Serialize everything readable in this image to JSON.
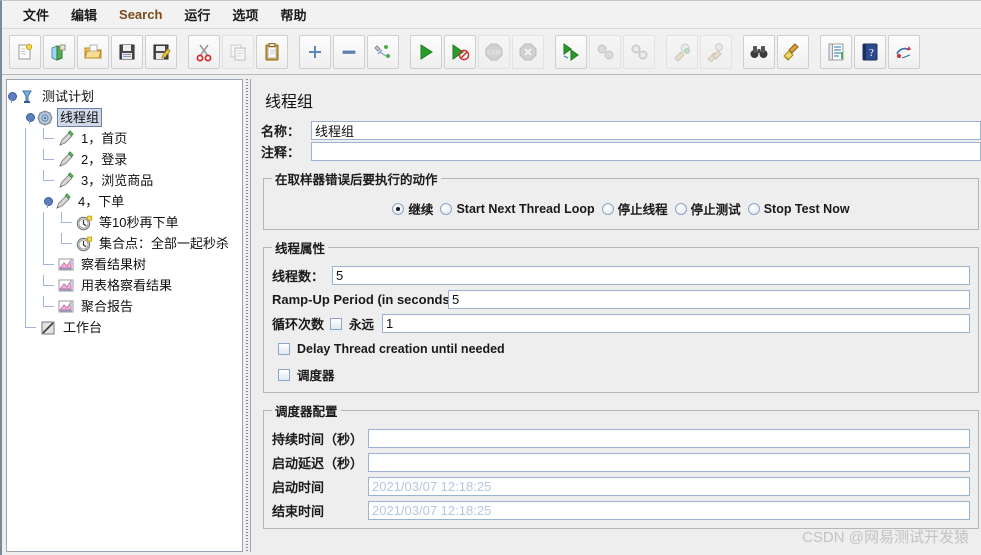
{
  "menubar": {
    "items": [
      {
        "label": "文件",
        "accent": false
      },
      {
        "label": "编辑",
        "accent": false
      },
      {
        "label": "Search",
        "accent": true
      },
      {
        "label": "运行",
        "accent": false
      },
      {
        "label": "选项",
        "accent": false
      },
      {
        "label": "帮助",
        "accent": false
      }
    ]
  },
  "toolbar": {
    "buttons": [
      {
        "icon": "new-file-icon",
        "disabled": false,
        "sep_after": false
      },
      {
        "icon": "templates-icon",
        "disabled": false,
        "sep_after": false
      },
      {
        "icon": "open-folder-icon",
        "disabled": false,
        "sep_after": false
      },
      {
        "icon": "save-icon",
        "disabled": false,
        "sep_after": false
      },
      {
        "icon": "save-as-icon",
        "disabled": false,
        "sep_after": true
      },
      {
        "icon": "cut-icon",
        "disabled": false,
        "sep_after": false
      },
      {
        "icon": "copy-icon",
        "disabled": true,
        "sep_after": false
      },
      {
        "icon": "paste-icon",
        "disabled": false,
        "sep_after": true
      },
      {
        "icon": "expand-all-icon",
        "disabled": false,
        "sep_after": false
      },
      {
        "icon": "collapse-all-icon",
        "disabled": false,
        "sep_after": false
      },
      {
        "icon": "toggle-icon",
        "disabled": false,
        "sep_after": true
      },
      {
        "icon": "start-icon",
        "disabled": false,
        "sep_after": false
      },
      {
        "icon": "start-no-pauses-icon",
        "disabled": false,
        "sep_after": false
      },
      {
        "icon": "stop-icon",
        "disabled": true,
        "sep_after": false
      },
      {
        "icon": "shutdown-icon",
        "disabled": true,
        "sep_after": true
      },
      {
        "icon": "start-remote-all-icon",
        "disabled": false,
        "sep_after": false
      },
      {
        "icon": "stop-remote-all-icon",
        "disabled": true,
        "sep_after": false
      },
      {
        "icon": "shutdown-remote-all-icon",
        "disabled": true,
        "sep_after": true
      },
      {
        "icon": "clear-icon",
        "disabled": true,
        "sep_after": false
      },
      {
        "icon": "clear-all-icon",
        "disabled": true,
        "sep_after": true
      },
      {
        "icon": "search-binoculars-icon",
        "disabled": false,
        "sep_after": false
      },
      {
        "icon": "reset-search-broom-icon",
        "disabled": false,
        "sep_after": true
      },
      {
        "icon": "function-helper-icon",
        "disabled": false,
        "sep_after": false
      },
      {
        "icon": "help-icon",
        "disabled": false,
        "sep_after": false
      },
      {
        "icon": "undo-redo-icon",
        "disabled": false,
        "sep_after": false
      }
    ]
  },
  "tree": {
    "nodes": [
      {
        "label": "测试计划",
        "icon": "test-plan-icon",
        "depth": 0,
        "selected": false,
        "expandable": true
      },
      {
        "label": "线程组",
        "icon": "thread-group-icon",
        "depth": 1,
        "selected": true,
        "expandable": true
      },
      {
        "label": "1，首页",
        "icon": "http-sampler-icon",
        "depth": 2,
        "selected": false,
        "expandable": false
      },
      {
        "label": "2，登录",
        "icon": "http-sampler-icon",
        "depth": 2,
        "selected": false,
        "expandable": false
      },
      {
        "label": "3，浏览商品",
        "icon": "http-sampler-icon",
        "depth": 2,
        "selected": false,
        "expandable": false
      },
      {
        "label": "4，下单",
        "icon": "http-sampler-icon",
        "depth": 2,
        "selected": false,
        "expandable": true
      },
      {
        "label": "等10秒再下单",
        "icon": "timer-icon",
        "depth": 3,
        "selected": false,
        "expandable": false
      },
      {
        "label": "集合点：全部一起秒杀",
        "icon": "timer-icon",
        "depth": 3,
        "selected": false,
        "expandable": false
      },
      {
        "label": "察看结果树",
        "icon": "listener-icon",
        "depth": 2,
        "selected": false,
        "expandable": false
      },
      {
        "label": "用表格察看结果",
        "icon": "listener-icon",
        "depth": 2,
        "selected": false,
        "expandable": false
      },
      {
        "label": "聚合报告",
        "icon": "listener-icon",
        "depth": 2,
        "selected": false,
        "expandable": false
      },
      {
        "label": "工作台",
        "icon": "workbench-icon",
        "depth": 1,
        "selected": false,
        "expandable": false
      }
    ]
  },
  "detail": {
    "title": "线程组",
    "name_label": "名称：",
    "name_value": "线程组",
    "comment_label": "注释：",
    "comment_value": "",
    "error_action": {
      "legend": "在取样器错误后要执行的动作",
      "options": [
        {
          "label": "继续",
          "checked": true
        },
        {
          "label": "Start Next Thread Loop",
          "checked": false
        },
        {
          "label": "停止线程",
          "checked": false
        },
        {
          "label": "停止测试",
          "checked": false
        },
        {
          "label": "Stop Test Now",
          "checked": false
        }
      ]
    },
    "thread_properties": {
      "legend": "线程属性",
      "thread_count_label": "线程数：",
      "thread_count_value": "5",
      "ramp_up_label": "Ramp-Up Period (in seconds):",
      "ramp_up_value": "5",
      "loop_label": "循环次数",
      "forever_label": "永远",
      "forever_checked": false,
      "loop_value": "1",
      "delay_thread_label": "Delay Thread creation until needed",
      "delay_thread_checked": false,
      "scheduler_label": "调度器",
      "scheduler_checked": false
    },
    "scheduler_config": {
      "legend": "调度器配置",
      "duration_label": "持续时间（秒）",
      "duration_value": "",
      "startup_delay_label": "启动延迟（秒）",
      "startup_delay_value": "",
      "start_time_label": "启动时间",
      "start_time_value": "2021/03/07 12:18:25",
      "end_time_label": "结束时间",
      "end_time_value": "2021/03/07 12:18:25"
    }
  },
  "watermark": "CSDN @网易测试开发猿",
  "colors": {
    "accent_menu": "#7a4a1e",
    "selection": "#cfd9ea",
    "panel_bg": "#eeeeee",
    "field_border": "#9bb2d0",
    "run_green": "#2a9b2a",
    "watermark": "#c3c3c3"
  }
}
